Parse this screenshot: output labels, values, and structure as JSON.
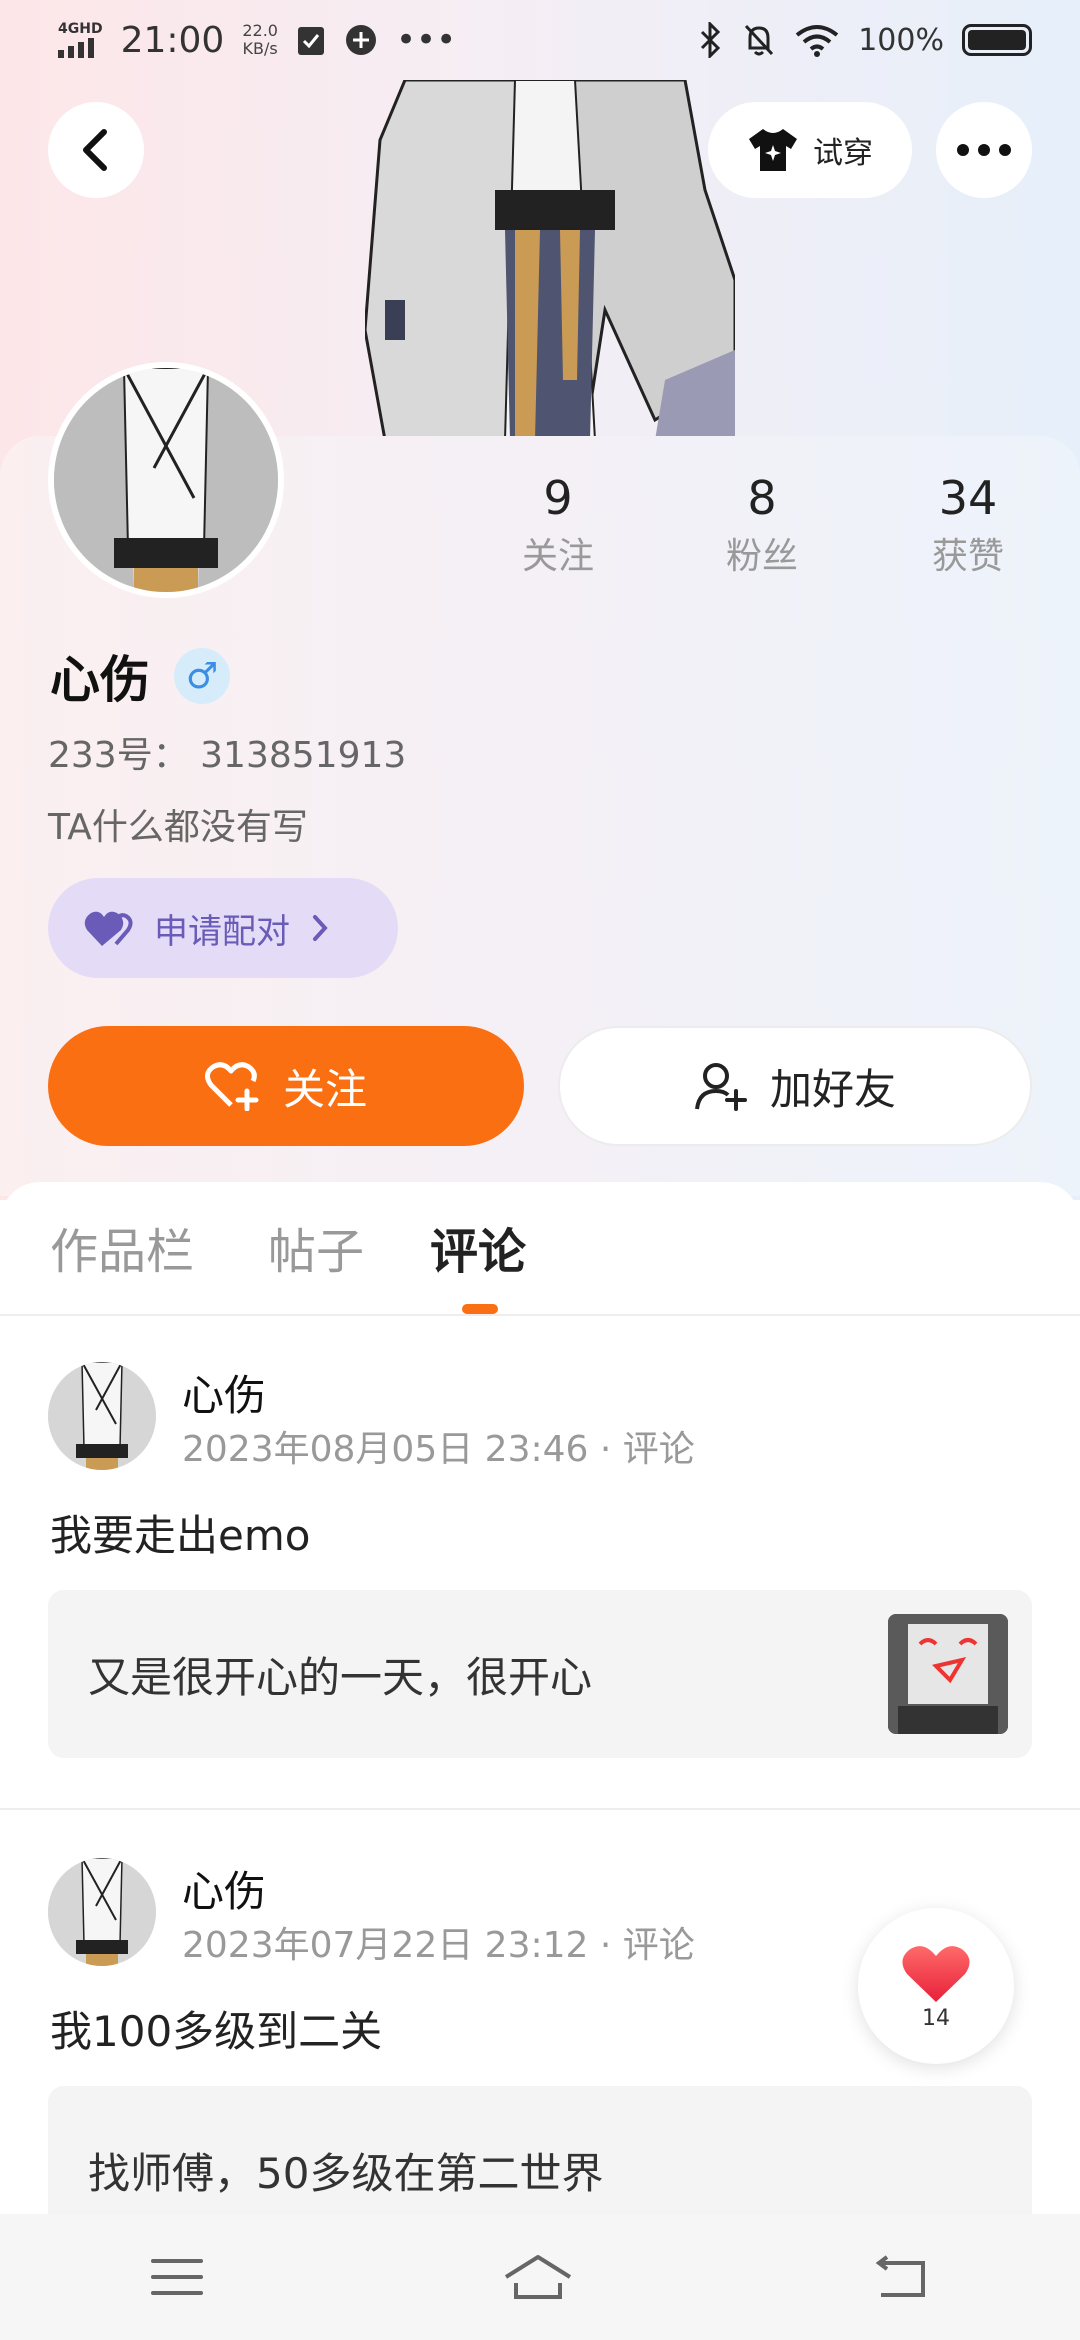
{
  "status_bar": {
    "network": "4GHD",
    "time": "21:00",
    "speed_value": "22.0",
    "speed_unit": "KB/s",
    "battery": "100%"
  },
  "header": {
    "try_on_label": "试穿"
  },
  "profile": {
    "username": "心伤",
    "gender_symbol": "♂",
    "uid": "233号： 313851913",
    "bio": "TA什么都没有写",
    "pair_label": "申请配对",
    "stats": [
      {
        "num": "9",
        "label": "关注"
      },
      {
        "num": "8",
        "label": "粉丝"
      },
      {
        "num": "34",
        "label": "获赞"
      }
    ],
    "follow_label": "关注",
    "add_friend_label": "加好友"
  },
  "tabs": [
    {
      "label": "作品栏"
    },
    {
      "label": "帖子"
    },
    {
      "label": "评论"
    }
  ],
  "posts": [
    {
      "name": "心伤",
      "meta": "2023年08月05日 23:46 · 评论",
      "text": "我要走出emo",
      "quote": "又是很开心的一天，很开心"
    },
    {
      "name": "心伤",
      "meta": "2023年07月22日 23:12 · 评论",
      "text": "我100多级到二关",
      "quote": "找师傅，50多级在第二世界"
    }
  ],
  "like_float": {
    "count": "14"
  },
  "colors": {
    "accent": "#fb6f13",
    "pair_bg": "#e4dcf6",
    "pair_text": "#6a5bb8",
    "like_red": "#f23b4a"
  }
}
